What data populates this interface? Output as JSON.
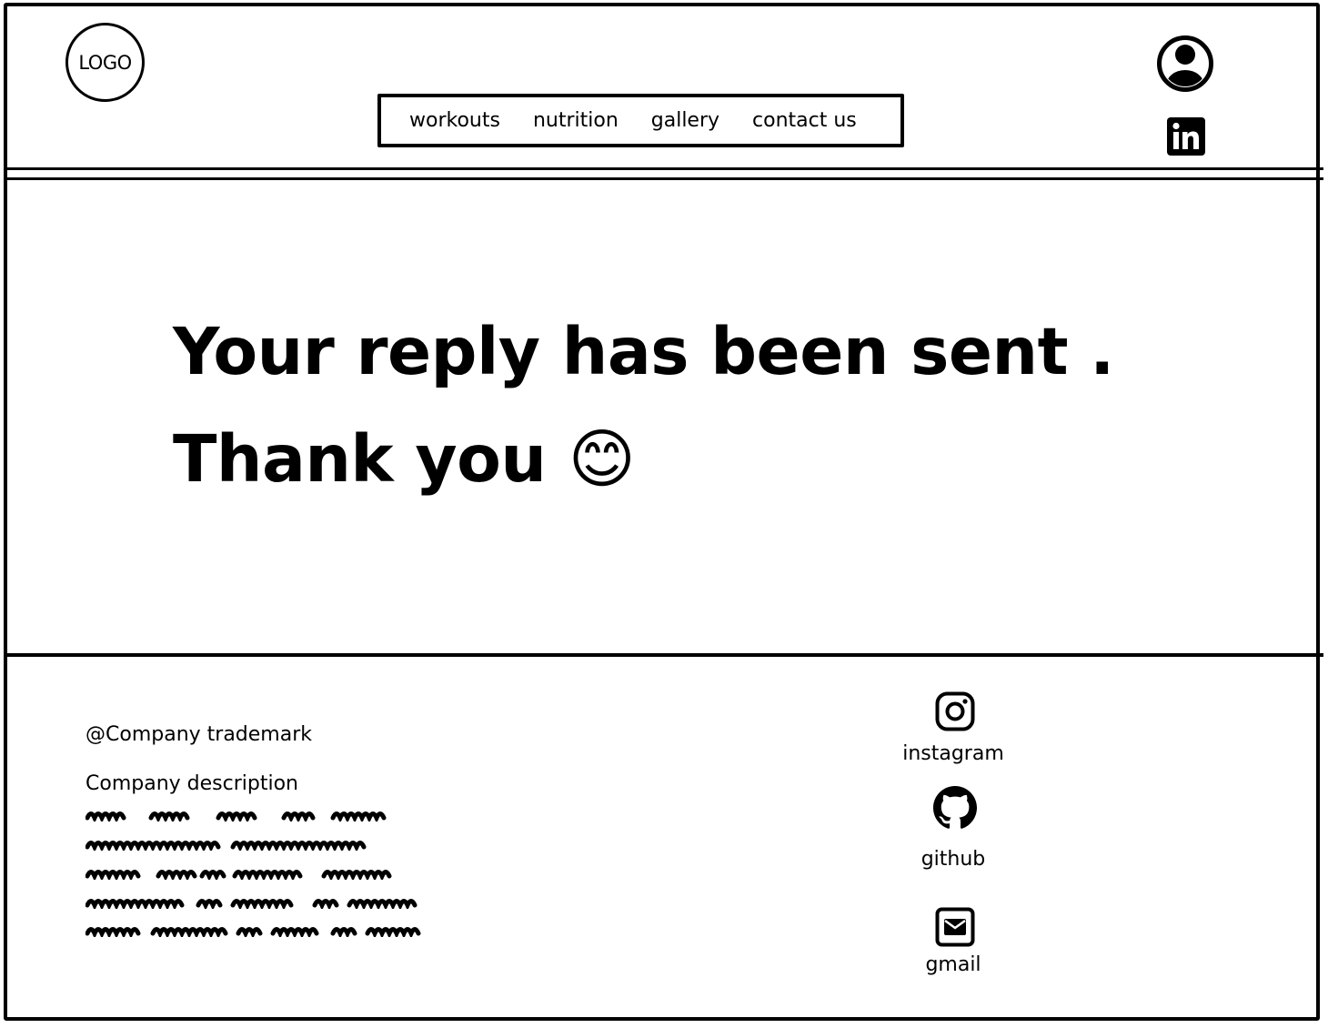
{
  "header": {
    "logo_text": "LOGO",
    "nav": [
      {
        "label": "workouts"
      },
      {
        "label": "nutrition"
      },
      {
        "label": "gallery"
      },
      {
        "label": "contact us"
      }
    ],
    "icons": [
      "user-avatar-icon",
      "linkedin-icon"
    ]
  },
  "main": {
    "line1": "Your reply has been sent .",
    "line2": "Thank you 😊"
  },
  "footer": {
    "trademark": "@Company trademark",
    "description_title": "Company description",
    "social": [
      {
        "label": "instagram",
        "icon": "instagram-icon"
      },
      {
        "label": "github",
        "icon": "github-icon"
      },
      {
        "label": "gmail",
        "icon": "mail-icon"
      }
    ]
  }
}
